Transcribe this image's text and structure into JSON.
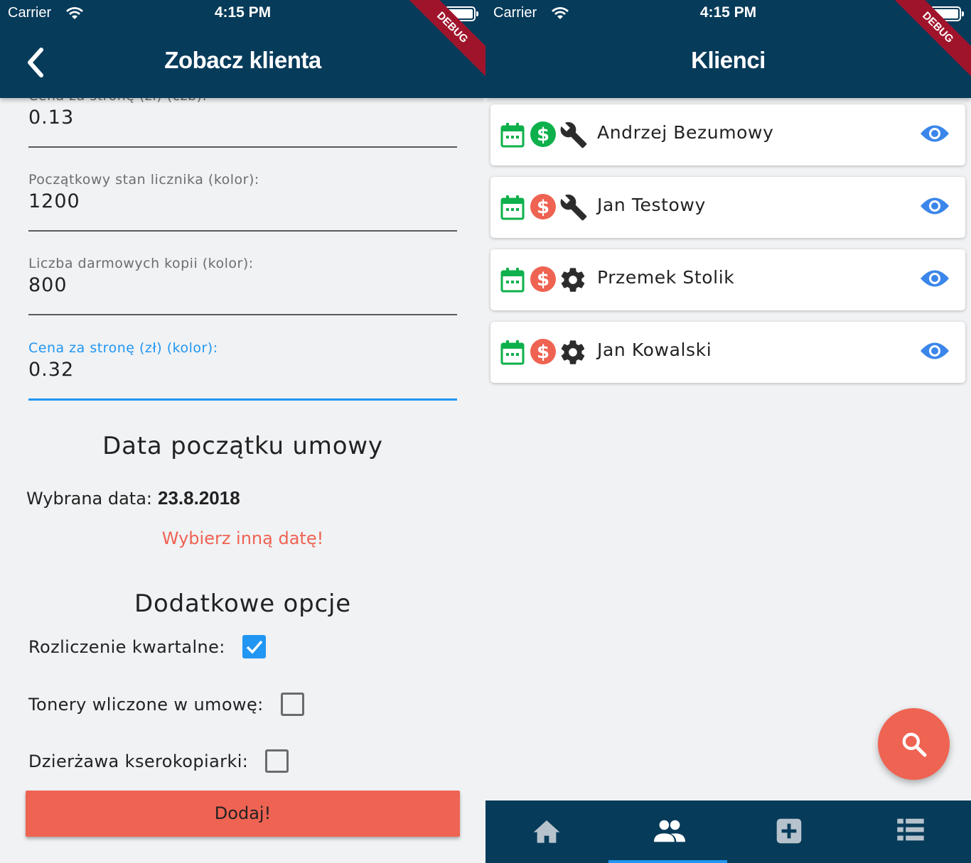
{
  "status": {
    "carrier": "Carrier",
    "time": "4:15 PM"
  },
  "debug_banner": "DEBUG",
  "client_view": {
    "title": "Zobacz klienta",
    "partial_label": "Cena za stronę (zł) (czb):",
    "fields": [
      {
        "label": "Cena za stronę (zł) (czb):",
        "value": "0.13"
      },
      {
        "label": "Początkowy stan licznika (kolor):",
        "value": "1200"
      },
      {
        "label": "Liczba darmowych kopii (kolor):",
        "value": "800"
      },
      {
        "label": "Cena za stronę (zł) (kolor):",
        "value": "0.32"
      }
    ],
    "contract_section_title": "Data początku umowy",
    "selected_date_label": "Wybrana data:",
    "selected_date_value": "23.8.2018",
    "pick_date_label": "Wybierz inną datę!",
    "options_section_title": "Dodatkowe opcje",
    "options": [
      {
        "label": "Rozliczenie kwartalne:",
        "checked": true
      },
      {
        "label": "Tonery wliczone w umowę:",
        "checked": false
      },
      {
        "label": "Dzierżawa kserokopiarki:",
        "checked": false
      }
    ],
    "submit_label": "Dodaj!"
  },
  "clients_list": {
    "title": "Klienci",
    "items": [
      {
        "name": "Andrzej Bezumowy",
        "payment_status": "paid",
        "service_icon": "wrench-icon"
      },
      {
        "name": "Jan Testowy",
        "payment_status": "unpaid",
        "service_icon": "wrench-icon"
      },
      {
        "name": "Przemek Stolik",
        "payment_status": "unpaid",
        "service_icon": "gear-icon"
      },
      {
        "name": "Jan Kowalski",
        "payment_status": "unpaid",
        "service_icon": "gear-icon"
      }
    ],
    "bottom_nav": [
      "home-icon",
      "people-icon",
      "add-box-icon",
      "list-icon"
    ],
    "active_nav_index": 1
  },
  "colors": {
    "appbar": "#073b5a",
    "accent_blue": "#2196f3",
    "danger_red": "#ef6352",
    "paid_green": "#0db04b",
    "calendar_green": "#0db04b",
    "eye_blue": "#3b86ea"
  }
}
